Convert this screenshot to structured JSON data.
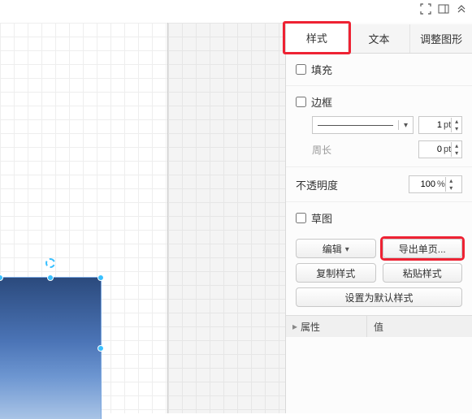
{
  "toolbar": {
    "fullscreen_icon": "fullscreen",
    "sidebar_icon": "sidebar",
    "collapse_icon": "collapse"
  },
  "tabs": {
    "style": "样式",
    "text": "文本",
    "shape": "调整图形"
  },
  "style": {
    "fill": {
      "label": "填充",
      "checked": false
    },
    "border": {
      "label": "边框",
      "checked": false,
      "width_value": "1",
      "width_unit": "pt",
      "perimeter_label": "周长",
      "perimeter_value": "0",
      "perimeter_unit": "pt"
    },
    "opacity": {
      "label": "不透明度",
      "value": "100",
      "unit": "%"
    },
    "sketch": {
      "label": "草图",
      "checked": false
    },
    "buttons": {
      "edit": "编辑",
      "export_page": "导出单页...",
      "copy_style": "复制样式",
      "paste_style": "粘贴样式",
      "set_default": "设置为默认样式"
    }
  },
  "properties": {
    "header_attr": "属性",
    "header_value": "值"
  }
}
